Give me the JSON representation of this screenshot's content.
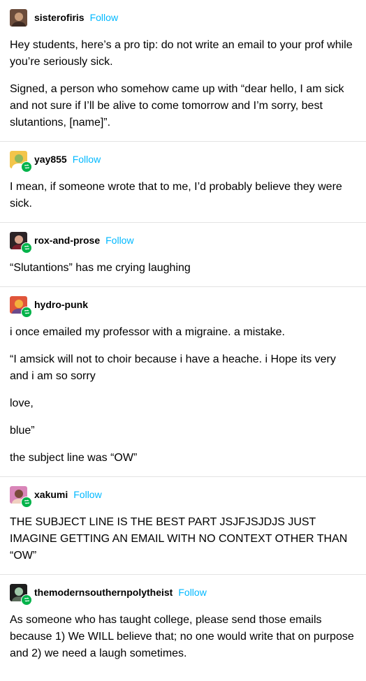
{
  "posts": [
    {
      "username": "sisterofiris",
      "follow_label": "Follow",
      "has_reblog_badge": false,
      "avatar_colors": [
        "#6b4c3b",
        "#c89c7a",
        "#3d2a22"
      ],
      "paragraphs": [
        "Hey students, here’s a pro tip: do not write an email to your prof while you’re seriously sick.",
        "Signed, a person who somehow came up with “dear hello, I am sick and not sure if I’ll be alive to come tomorrow and I’m sorry, best slutantions, [name]”."
      ]
    },
    {
      "username": "yay855",
      "follow_label": "Follow",
      "has_reblog_badge": true,
      "avatar_colors": [
        "#f3c54a",
        "#8fb85c",
        "#ffffff"
      ],
      "paragraphs": [
        "I mean, if someone wrote that to me, I’d probably believe they were sick."
      ]
    },
    {
      "username": "rox-and-prose",
      "follow_label": "Follow",
      "has_reblog_badge": true,
      "avatar_colors": [
        "#2b2326",
        "#d9a38d",
        "#7a1f2c"
      ],
      "paragraphs": [
        "“Slutantions” has me crying laughing"
      ]
    },
    {
      "username": "hydro-punk",
      "follow_label": "",
      "has_reblog_badge": true,
      "avatar_colors": [
        "#e0553a",
        "#f4b03c",
        "#6b4a8b"
      ],
      "paragraphs": [
        "i once emailed my professor with a migraine. a mistake.",
        "“I amsick will not to choir because i have a heache. i Hope its very and i am so sorry",
        "love,",
        "blue”",
        "the subject line was “OW”"
      ]
    },
    {
      "username": "xakumi",
      "follow_label": "Follow",
      "has_reblog_badge": true,
      "avatar_colors": [
        "#d985b8",
        "#7a4a3a",
        "#f0d0c0"
      ],
      "paragraphs": [
        "THE SUBJECT LINE IS THE BEST PART JSJFJSJDJS JUST IMAGINE GETTING AN EMAIL WITH NO CONTEXT OTHER THAN “OW”"
      ]
    },
    {
      "username": "themodernsouthernpolytheist",
      "follow_label": "Follow",
      "has_reblog_badge": true,
      "avatar_colors": [
        "#1d1d1d",
        "#9fc7a8",
        "#5a6b5a"
      ],
      "paragraphs": [
        "As someone who has taught college, please send those emails because 1) We WILL believe that; no one would write that on purpose and 2) we need a laugh sometimes."
      ]
    }
  ]
}
